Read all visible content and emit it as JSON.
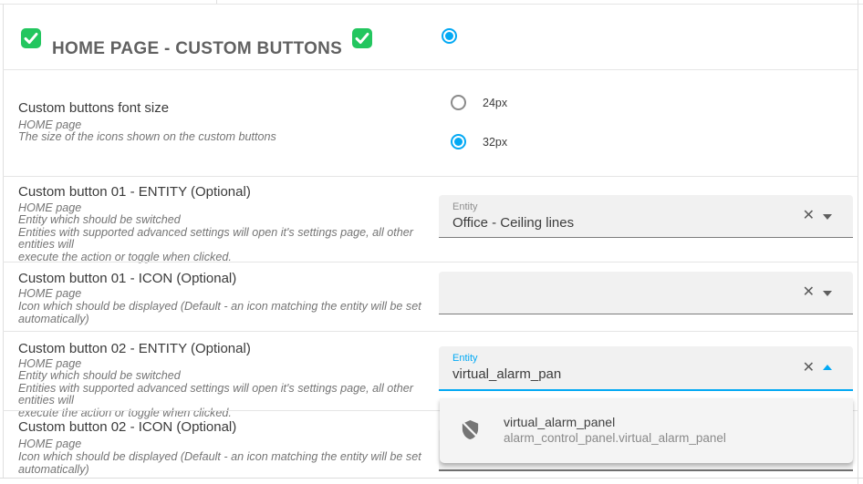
{
  "colors": {
    "accent_blue": "#03a9f4",
    "checkbox_green": "#23c65f",
    "field_background": "#f1f1f1",
    "divider": "#e5e5e5"
  },
  "header": {
    "title": "HOME PAGE - CUSTOM BUTTONS",
    "left_icon": "check-square-icon",
    "right_icon": "check-square-icon",
    "radio_selected": true
  },
  "sections": {
    "font_size": {
      "title": "Custom buttons font size",
      "desc": [
        "HOME page",
        "The size of the icons shown on the custom buttons"
      ],
      "options": {
        "opt24": "24px",
        "opt32": "32px"
      },
      "selected": "32px"
    },
    "button01_entity": {
      "title": "Custom button 01 - ENTITY (Optional)",
      "desc": [
        "HOME page",
        "Entity which should be switched",
        "Entities with supported advanced settings will open it's settings page, all other entities will",
        "execute the action or toggle when clicked."
      ],
      "field_label": "Entity",
      "field_value": "Office - Ceiling lines"
    },
    "button01_icon": {
      "title": "Custom button 01 - ICON (Optional)",
      "desc": [
        "HOME page",
        "Icon which should be displayed (Default - an icon matching the entity will be set",
        "automatically)"
      ],
      "field_value": ""
    },
    "button02_entity": {
      "title": "Custom button 02 - ENTITY (Optional)",
      "desc": [
        "HOME page",
        "Entity which should be switched",
        "Entities with supported advanced settings will open it's settings page, all other entities will",
        "execute the action or toggle when clicked."
      ],
      "field_label": "Entity",
      "field_value": "virtual_alarm_pan",
      "focused": true
    },
    "button02_icon": {
      "title": "Custom button 02 - ICON (Optional)",
      "desc": [
        "HOME page",
        "Icon which should be displayed (Default - an icon matching the entity will be set",
        "automatically)"
      ]
    }
  },
  "entity_menu": {
    "item": {
      "icon": "shield-off-icon",
      "primary": "virtual_alarm_panel",
      "secondary": "alarm_control_panel.virtual_alarm_panel"
    }
  }
}
